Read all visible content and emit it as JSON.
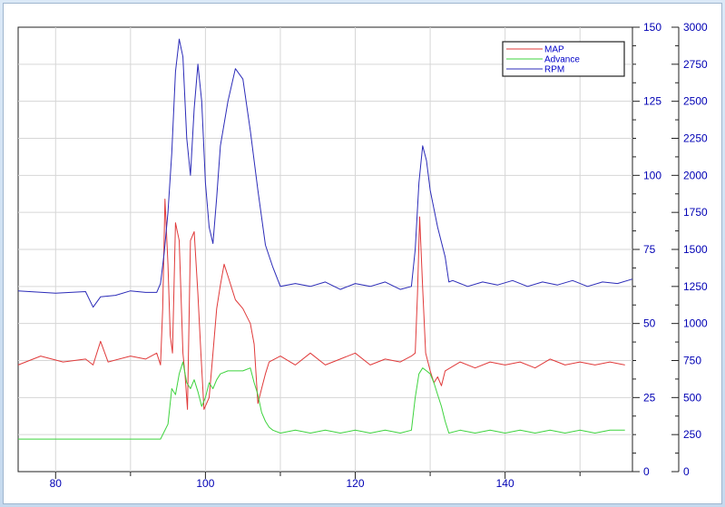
{
  "chart_data": {
    "type": "line",
    "grid": true,
    "legend_placement": "top-right",
    "x_ticks": [
      80,
      100,
      120,
      140
    ],
    "xlim": [
      75,
      157
    ],
    "y_left": {
      "ticks": [
        0,
        25,
        50,
        75,
        100,
        125,
        150
      ],
      "ylim": [
        0,
        150
      ]
    },
    "y_right": {
      "ticks": [
        0,
        250,
        500,
        750,
        1000,
        1250,
        1500,
        1750,
        2000,
        2250,
        2500,
        2750,
        3000
      ],
      "ylim": [
        0,
        3000
      ]
    },
    "series": [
      {
        "name": "MAP",
        "axis": "left",
        "color": "#e03a3a",
        "points": [
          [
            75,
            36
          ],
          [
            78,
            39
          ],
          [
            81,
            37
          ],
          [
            84,
            38
          ],
          [
            85,
            36
          ],
          [
            86,
            44
          ],
          [
            87,
            37
          ],
          [
            90,
            39
          ],
          [
            92,
            38
          ],
          [
            93.5,
            40
          ],
          [
            94,
            36
          ],
          [
            94.3,
            55
          ],
          [
            94.6,
            92
          ],
          [
            95,
            70
          ],
          [
            95.3,
            46
          ],
          [
            95.6,
            40
          ],
          [
            96,
            84
          ],
          [
            96.5,
            78
          ],
          [
            97,
            40
          ],
          [
            97.3,
            32
          ],
          [
            97.6,
            21
          ],
          [
            98,
            78
          ],
          [
            98.5,
            81
          ],
          [
            99,
            60
          ],
          [
            99.4,
            40
          ],
          [
            99.8,
            21
          ],
          [
            100.5,
            25
          ],
          [
            101,
            40
          ],
          [
            101.5,
            55
          ],
          [
            102,
            63
          ],
          [
            102.5,
            70
          ],
          [
            103,
            66
          ],
          [
            104,
            58
          ],
          [
            105,
            55
          ],
          [
            106,
            50
          ],
          [
            106.5,
            43
          ],
          [
            107,
            23
          ],
          [
            107.5,
            28
          ],
          [
            108,
            33
          ],
          [
            108.5,
            37
          ],
          [
            110,
            39
          ],
          [
            112,
            36
          ],
          [
            114,
            40
          ],
          [
            116,
            36
          ],
          [
            118,
            38
          ],
          [
            120,
            40
          ],
          [
            122,
            36
          ],
          [
            124,
            38
          ],
          [
            126,
            37
          ],
          [
            127.5,
            39
          ],
          [
            128,
            40
          ],
          [
            128.3,
            60
          ],
          [
            128.6,
            86
          ],
          [
            129,
            62
          ],
          [
            129.4,
            40
          ],
          [
            130,
            34
          ],
          [
            130.5,
            30
          ],
          [
            131,
            32
          ],
          [
            131.5,
            29
          ],
          [
            132,
            34
          ],
          [
            134,
            37
          ],
          [
            136,
            35
          ],
          [
            138,
            37
          ],
          [
            140,
            36
          ],
          [
            142,
            37
          ],
          [
            144,
            35
          ],
          [
            146,
            38
          ],
          [
            148,
            36
          ],
          [
            150,
            37
          ],
          [
            152,
            36
          ],
          [
            154,
            37
          ],
          [
            156,
            36
          ]
        ]
      },
      {
        "name": "Advance",
        "axis": "left",
        "color": "#3ed33e",
        "points": [
          [
            75,
            11
          ],
          [
            80,
            11
          ],
          [
            85,
            11
          ],
          [
            90,
            11
          ],
          [
            94,
            11
          ],
          [
            95,
            16
          ],
          [
            95.5,
            28
          ],
          [
            96,
            26
          ],
          [
            96.5,
            33
          ],
          [
            97,
            37
          ],
          [
            97.5,
            30
          ],
          [
            98,
            28
          ],
          [
            98.5,
            31
          ],
          [
            99,
            27
          ],
          [
            99.5,
            22
          ],
          [
            100,
            25
          ],
          [
            100.5,
            30
          ],
          [
            101,
            28
          ],
          [
            101.5,
            31
          ],
          [
            102,
            33
          ],
          [
            103,
            34
          ],
          [
            104,
            34
          ],
          [
            105,
            34
          ],
          [
            106,
            35
          ],
          [
            106.5,
            30
          ],
          [
            107,
            26
          ],
          [
            107.5,
            20
          ],
          [
            108,
            17
          ],
          [
            108.5,
            15
          ],
          [
            109,
            14
          ],
          [
            110,
            13
          ],
          [
            112,
            14
          ],
          [
            114,
            13
          ],
          [
            116,
            14
          ],
          [
            118,
            13
          ],
          [
            120,
            14
          ],
          [
            122,
            13
          ],
          [
            124,
            14
          ],
          [
            126,
            13
          ],
          [
            127.5,
            14
          ],
          [
            128,
            25
          ],
          [
            128.5,
            33
          ],
          [
            129,
            35
          ],
          [
            129.5,
            34
          ],
          [
            130,
            33
          ],
          [
            130.5,
            30
          ],
          [
            131,
            26
          ],
          [
            131.5,
            22
          ],
          [
            132,
            17
          ],
          [
            132.5,
            13
          ],
          [
            134,
            14
          ],
          [
            136,
            13
          ],
          [
            138,
            14
          ],
          [
            140,
            13
          ],
          [
            142,
            14
          ],
          [
            144,
            13
          ],
          [
            146,
            14
          ],
          [
            148,
            13
          ],
          [
            150,
            14
          ],
          [
            152,
            13
          ],
          [
            154,
            14
          ],
          [
            156,
            14
          ]
        ]
      },
      {
        "name": "RPM",
        "axis": "right",
        "color": "#2b2bb8",
        "points": [
          [
            75,
            1220
          ],
          [
            80,
            1205
          ],
          [
            84,
            1215
          ],
          [
            85,
            1110
          ],
          [
            86,
            1180
          ],
          [
            88,
            1190
          ],
          [
            90,
            1220
          ],
          [
            92,
            1210
          ],
          [
            93.5,
            1210
          ],
          [
            94,
            1270
          ],
          [
            94.5,
            1480
          ],
          [
            95,
            1750
          ],
          [
            95.5,
            2150
          ],
          [
            96,
            2700
          ],
          [
            96.5,
            2920
          ],
          [
            97,
            2800
          ],
          [
            97.5,
            2250
          ],
          [
            98,
            2000
          ],
          [
            98.5,
            2450
          ],
          [
            99,
            2750
          ],
          [
            99.5,
            2500
          ],
          [
            100,
            1950
          ],
          [
            100.5,
            1650
          ],
          [
            101,
            1540
          ],
          [
            101.5,
            1850
          ],
          [
            102,
            2200
          ],
          [
            103,
            2500
          ],
          [
            104,
            2720
          ],
          [
            105,
            2650
          ],
          [
            106,
            2300
          ],
          [
            107,
            1900
          ],
          [
            108,
            1530
          ],
          [
            109,
            1380
          ],
          [
            110,
            1250
          ],
          [
            112,
            1270
          ],
          [
            114,
            1250
          ],
          [
            116,
            1280
          ],
          [
            118,
            1230
          ],
          [
            120,
            1270
          ],
          [
            122,
            1250
          ],
          [
            124,
            1280
          ],
          [
            126,
            1230
          ],
          [
            127.5,
            1250
          ],
          [
            128,
            1500
          ],
          [
            128.5,
            1950
          ],
          [
            129,
            2200
          ],
          [
            129.5,
            2100
          ],
          [
            130,
            1900
          ],
          [
            131,
            1650
          ],
          [
            132,
            1450
          ],
          [
            132.5,
            1280
          ],
          [
            133,
            1290
          ],
          [
            135,
            1250
          ],
          [
            137,
            1280
          ],
          [
            139,
            1260
          ],
          [
            141,
            1290
          ],
          [
            143,
            1250
          ],
          [
            145,
            1280
          ],
          [
            147,
            1260
          ],
          [
            149,
            1290
          ],
          [
            151,
            1250
          ],
          [
            153,
            1280
          ],
          [
            155,
            1270
          ],
          [
            157,
            1300
          ]
        ]
      }
    ]
  }
}
